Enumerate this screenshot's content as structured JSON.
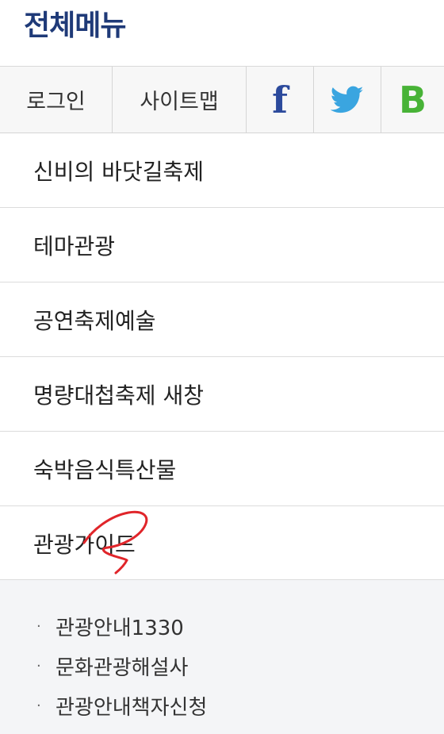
{
  "header": {
    "title": "전체메뉴"
  },
  "toolbar": {
    "login_label": "로그인",
    "sitemap_label": "사이트맵",
    "sns": [
      {
        "icon": "facebook-icon",
        "glyph": "f",
        "color": "#2c4a9c"
      },
      {
        "icon": "twitter-icon",
        "color": "#3aa5e0"
      },
      {
        "icon": "blog-icon",
        "glyph": "B",
        "color": "#48b337"
      }
    ]
  },
  "menu": {
    "items": [
      {
        "label": "신비의 바닷길축제"
      },
      {
        "label": "테마관광"
      },
      {
        "label": "공연축제예술"
      },
      {
        "label": "명량대첩축제 새창"
      },
      {
        "label": "숙박음식특산물"
      },
      {
        "label": "관광가이드"
      }
    ]
  },
  "submenu": {
    "bullet": "·",
    "items": [
      {
        "label": "관광안내1330"
      },
      {
        "label": "문화관광해설사"
      },
      {
        "label": "관광안내책자신청"
      }
    ]
  },
  "annotation": {
    "color": "#e0252a"
  }
}
